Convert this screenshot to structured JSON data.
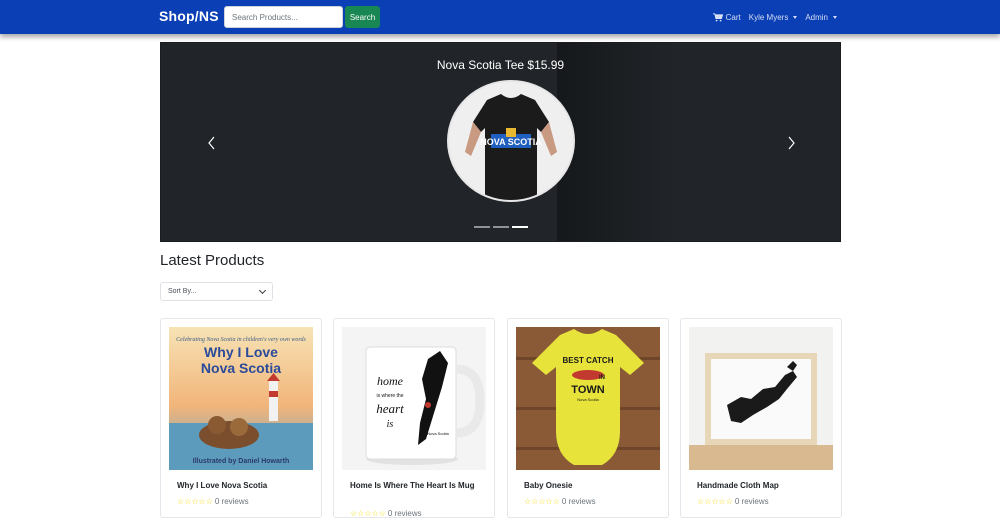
{
  "navbar": {
    "brand": "Shop/NS",
    "search_placeholder": "Search Products...",
    "search_button": "Search",
    "cart_label": "Cart",
    "user_label": "Kyle Myers",
    "admin_label": "Admin"
  },
  "carousel": {
    "caption": "Nova Scotia Tee $15.99",
    "shirt_text": "NOVA SCOTIA",
    "slide_count": 3,
    "active_slide": 3
  },
  "products": {
    "title": "Latest Products",
    "sort_label": "Sort By...",
    "items": [
      {
        "name": "Why I Love Nova Scotia",
        "reviews": "0 reviews",
        "stars": "☆☆☆☆☆",
        "cover_tagline": "Celebrating Nova Scotia in children's very own words",
        "cover_title_1": "Why I Love",
        "cover_title_2": "Nova Scotia",
        "cover_author": "Illustrated by Daniel Howarth"
      },
      {
        "name": "Home Is Where The Heart Is Mug",
        "reviews": "0 reviews",
        "stars": "☆☆☆☆☆",
        "mug_line1": "home",
        "mug_line2": "is where the",
        "mug_line3": "heart",
        "mug_line4": "is",
        "mug_map_label": "Nova Scotia"
      },
      {
        "name": "Baby Onesie",
        "reviews": "0 reviews",
        "stars": "☆☆☆☆☆",
        "onesie_line1": "BEST CATCH",
        "onesie_line2": "IN",
        "onesie_line3": "TOWN",
        "onesie_line4": "Nova Scotia"
      },
      {
        "name": "Handmade Cloth Map",
        "reviews": "0 reviews",
        "stars": "☆☆☆☆☆"
      }
    ]
  },
  "colors": {
    "navbar": "#0a3fb5",
    "search_button": "#198754",
    "carousel_bg": "#212529",
    "star": "#f5d90a"
  }
}
